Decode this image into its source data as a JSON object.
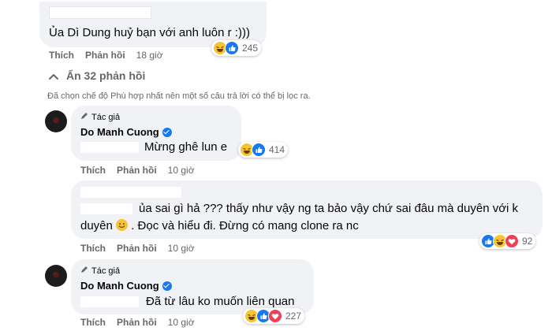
{
  "thread": {
    "top_comment": {
      "text": "Ủa Dì Dung huỷ bạn với anh luôn r :)))",
      "actions": {
        "like": "Thích",
        "reply": "Phản hồi",
        "time": "18 giờ"
      },
      "reactions": {
        "icons": [
          "haha-icon",
          "like-icon"
        ],
        "count": "245"
      }
    },
    "toggle": {
      "label": "Ẩn 32 phản hồi"
    },
    "filter_note": "Đã chọn chế độ Phù hợp nhất nên một số câu trả lời có thể bị lọc ra.",
    "replies": [
      {
        "author_tag": "Tác giả",
        "author": "Do Manh Cuong",
        "text": "Mừng ghê lun e",
        "actions": {
          "like": "Thích",
          "reply": "Phản hồi",
          "time": "10 giờ"
        },
        "reactions": {
          "icons": [
            "haha-icon",
            "like-icon"
          ],
          "count": "414"
        }
      },
      {
        "text_line1": "ủa sai gì hả ??? thấy như vậy ng ta bảo vậy chứ sai đâu mà duyên với k",
        "text_line2_a": "duyên",
        "text_line2_b": ". Đọc và hiểu đi. Đừng có mang clone ra nc",
        "actions": {
          "like": "Thích",
          "reply": "Phản hồi",
          "time": "10 giờ"
        },
        "reactions": {
          "icons": [
            "like-icon",
            "haha-icon",
            "love-icon"
          ],
          "count": "92"
        }
      },
      {
        "author_tag": "Tác giả",
        "author": "Do Manh Cuong",
        "text": "Đã từ lâu ko muốn liên quan",
        "actions": {
          "like": "Thích",
          "reply": "Phản hồi",
          "time": "10 giờ"
        },
        "reactions": {
          "icons": [
            "haha-icon",
            "like-icon",
            "love-icon"
          ],
          "count": "227"
        }
      }
    ]
  },
  "colors": {
    "bubble": "#f0f2f5",
    "meta_text": "#65676b",
    "like_blue": "#1877f2",
    "haha_yellow": "#f7c531",
    "love_red": "#f33e58"
  }
}
